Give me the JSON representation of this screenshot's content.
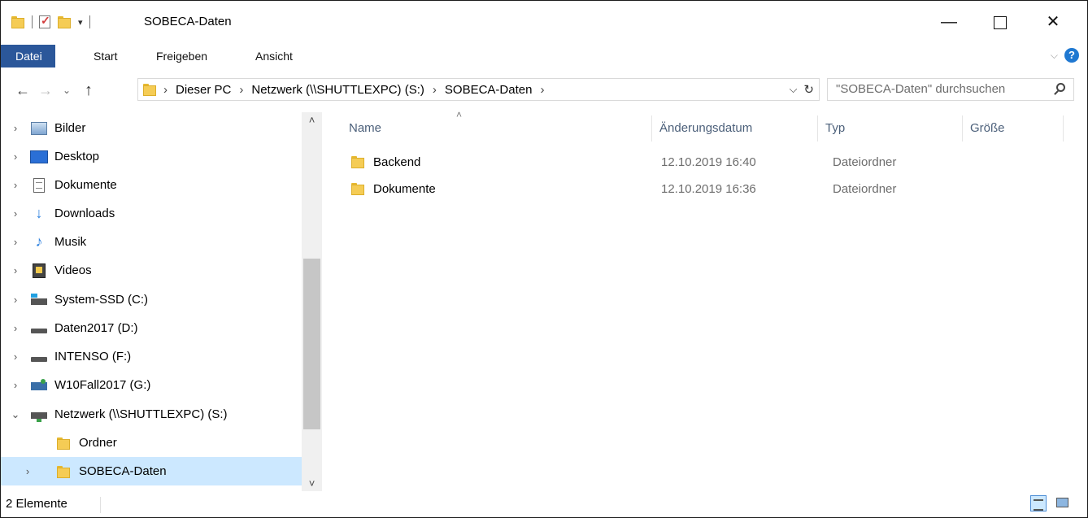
{
  "window": {
    "title": "SOBECA-Daten",
    "min_glyph": "—",
    "close_glyph": "✕"
  },
  "ribbon": {
    "tabs": [
      "Datei",
      "Start",
      "Freigeben",
      "Ansicht"
    ],
    "collapse_glyph": "⌵",
    "help_glyph": "?"
  },
  "nav": {
    "back": "←",
    "forward": "→",
    "recent": "⌄",
    "up": "↑",
    "address": [
      "Dieser PC",
      "Netzwerk (\\\\SHUTTLEXPC) (S:)",
      "SOBECA-Daten"
    ],
    "address_sep": "›",
    "dropdown_glyph": "⌵",
    "refresh_glyph": "↻",
    "search_placeholder": "\"SOBECA-Daten\" durchsuchen"
  },
  "sidebar": {
    "items": [
      {
        "label": "Bilder",
        "expander": "›",
        "icon": "pictures-icon"
      },
      {
        "label": "Desktop",
        "expander": "›",
        "icon": "desktop-icon"
      },
      {
        "label": "Dokumente",
        "expander": "›",
        "icon": "documents-icon"
      },
      {
        "label": "Downloads",
        "expander": "›",
        "icon": "downloads-icon"
      },
      {
        "label": "Musik",
        "expander": "›",
        "icon": "music-icon"
      },
      {
        "label": "Videos",
        "expander": "›",
        "icon": "videos-icon"
      },
      {
        "label": "System-SSD (C:)",
        "expander": "›",
        "icon": "system-drive-icon"
      },
      {
        "label": "Daten2017 (D:)",
        "expander": "›",
        "icon": "drive-icon"
      },
      {
        "label": "INTENSO (F:)",
        "expander": "›",
        "icon": "drive-icon"
      },
      {
        "label": "W10Fall2017 (G:)",
        "expander": "›",
        "icon": "usb-drive-icon"
      },
      {
        "label": "Netzwerk (\\\\SHUTTLEXPC) (S:)",
        "expander": "⌄",
        "icon": "network-drive-icon"
      },
      {
        "label": "Ordner",
        "expander": "",
        "icon": "folder-icon"
      },
      {
        "label": "SOBECA-Daten",
        "expander": "›",
        "icon": "folder-icon",
        "selected": true
      }
    ],
    "scroll_up": "˄",
    "scroll_down": "˅"
  },
  "filelist": {
    "columns": [
      "Name",
      "Änderungsdatum",
      "Typ",
      "Größe"
    ],
    "sort_caret": "˄",
    "rows": [
      {
        "name": "Backend",
        "date": "12.10.2019 16:40",
        "type": "Dateiordner",
        "size": ""
      },
      {
        "name": "Dokumente",
        "date": "12.10.2019 16:36",
        "type": "Dateiordner",
        "size": ""
      }
    ]
  },
  "status": {
    "count": "2 Elemente"
  },
  "colors": {
    "accent": "#2b579a",
    "selection": "#cce8ff",
    "folder": "#f5cc55"
  }
}
